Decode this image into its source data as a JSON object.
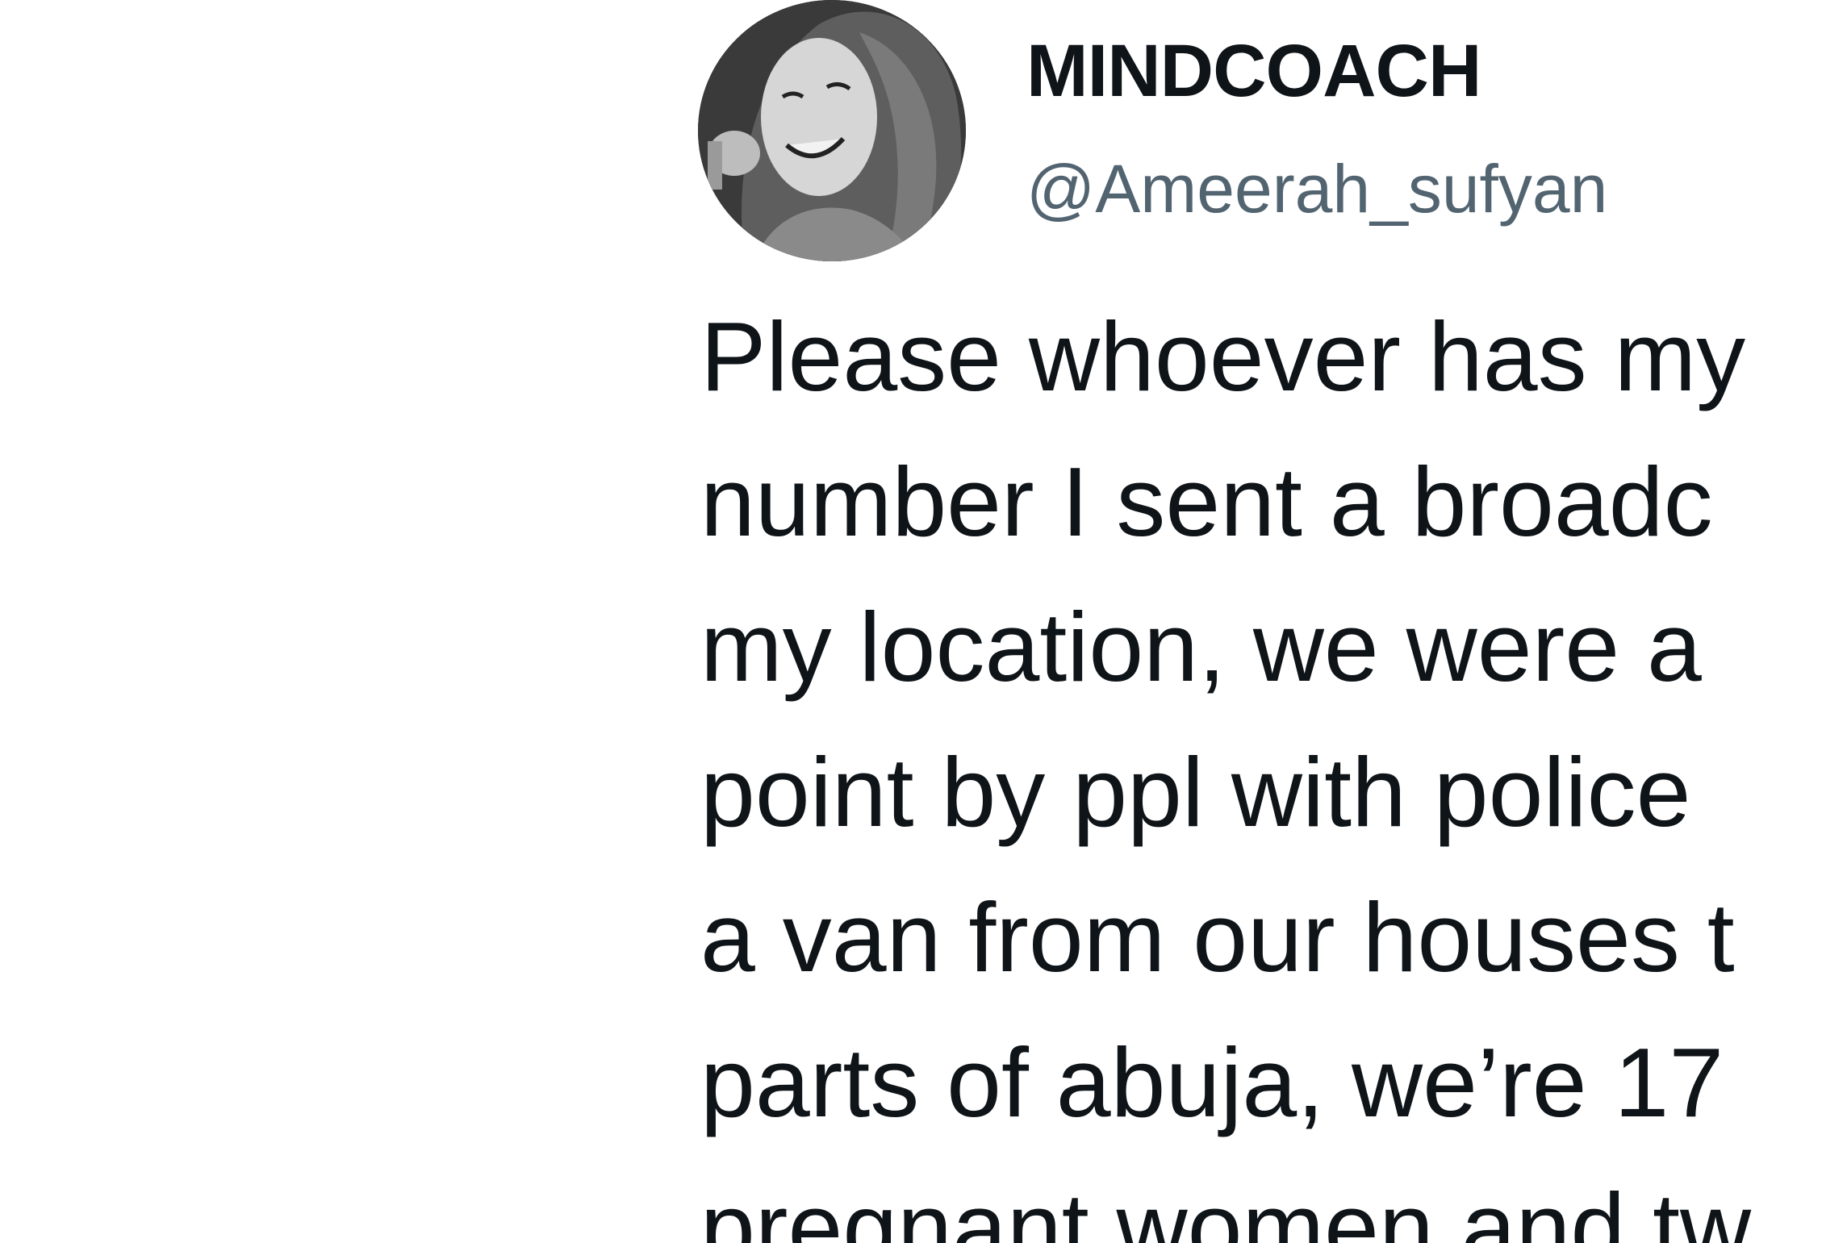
{
  "tweet": {
    "display_name": "MINDCOACH",
    "handle": "@Ameerah_sufyan",
    "avatar_icon": "profile-photo",
    "text_lines": [
      "Please whoever has my",
      "number I sent a broadc",
      "my location, we were a",
      "point by ppl with police",
      "a van from our houses t",
      "parts of abuja, we’re 17",
      "pregnant women and tw"
    ]
  },
  "colors": {
    "text": "#0f1419",
    "secondary_text": "#536471",
    "background": "#ffffff"
  }
}
